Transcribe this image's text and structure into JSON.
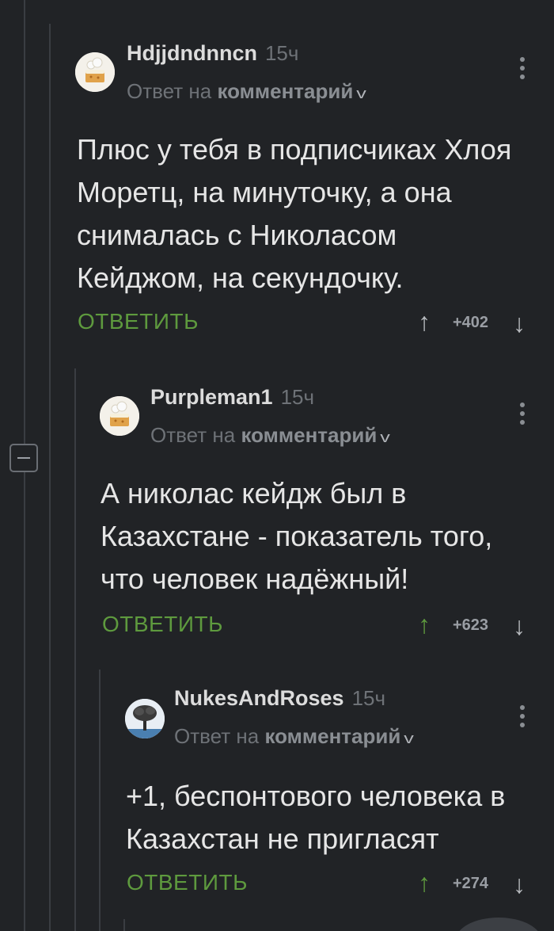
{
  "comments": [
    {
      "author": "Hdjjdndnncn",
      "time": "15ч",
      "reply_prefix": "Ответ на",
      "reply_target": "комментарий",
      "text": "Плюс у тебя в подписчиках Хлоя Моретц, на минуточку, а она снималась с Николасом Кейджом, на секундочку.",
      "reply_label": "ОТВЕТИТЬ",
      "score": "+402",
      "avatar": "cake-avatar",
      "upvoted": false
    },
    {
      "author": "Purpleman1",
      "time": "15ч",
      "reply_prefix": "Ответ на",
      "reply_target": "комментарий",
      "text": "А николас кейдж был в Казахстане - показатель того, что человек надёжный!",
      "reply_label": "ОТВЕТИТЬ",
      "score": "+623",
      "avatar": "cake-avatar",
      "upvoted": true
    },
    {
      "author": "NukesAndRoses",
      "time": "15ч",
      "reply_prefix": "Ответ на",
      "reply_target": "комментарий",
      "text": "+1, беспонтового человека в Казахстан не пригласят",
      "reply_label": "ОТВЕТИТЬ",
      "score": "+274",
      "avatar": "tree-avatar",
      "upvoted": true
    }
  ],
  "colors": {
    "background": "#212326",
    "accent_green": "#5e9a3e",
    "muted": "#6e7277"
  }
}
